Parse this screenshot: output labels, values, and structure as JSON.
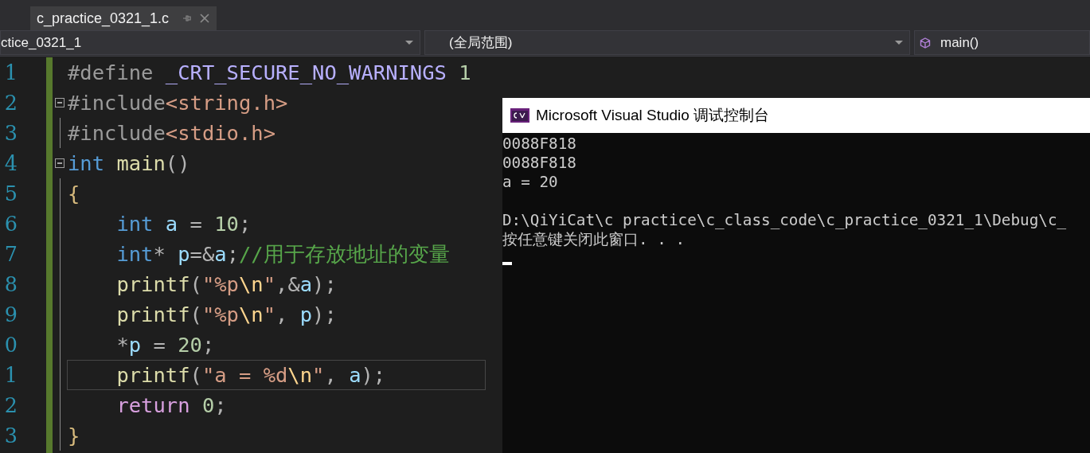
{
  "tab": {
    "label": "c_practice_0321_1.c",
    "selected": true
  },
  "nav_bar": [
    {
      "label": "ctice_0321_1",
      "kind": "dropdown"
    },
    {
      "label": "(全局范围)",
      "kind": "dropdown"
    },
    {
      "label": "main()",
      "kind": "member"
    }
  ],
  "editor": {
    "lines": [
      {
        "number": "1",
        "fold": false,
        "current": false,
        "tokens": [
          {
            "kind": "preproc",
            "text": "#define "
          },
          {
            "kind": "macro",
            "text": "_CRT_SECURE_NO_WARNINGS"
          },
          {
            "kind": "number",
            "text": " 1"
          }
        ]
      },
      {
        "number": "2",
        "fold": true,
        "current": false,
        "tokens": [
          {
            "kind": "preproc",
            "text": "#include"
          },
          {
            "kind": "string",
            "text": "<string.h>"
          }
        ]
      },
      {
        "number": "3",
        "fold": false,
        "current": false,
        "tokens": [
          {
            "kind": "preproc",
            "text": "#include"
          },
          {
            "kind": "string",
            "text": "<stdio.h>"
          }
        ]
      },
      {
        "number": "4",
        "fold": true,
        "current": false,
        "tokens": [
          {
            "kind": "keyword",
            "text": "int "
          },
          {
            "kind": "function",
            "text": "main"
          },
          {
            "kind": "punct",
            "text": "()"
          }
        ]
      },
      {
        "number": "5",
        "fold": false,
        "current": false,
        "tokens": [
          {
            "kind": "brace",
            "text": "{"
          }
        ]
      },
      {
        "number": "6",
        "fold": false,
        "current": false,
        "tokens": [
          {
            "kind": "keyword",
            "text": "    int "
          },
          {
            "kind": "variable",
            "text": "a"
          },
          {
            "kind": "punct",
            "text": " = "
          },
          {
            "kind": "number",
            "text": "10"
          },
          {
            "kind": "punct",
            "text": ";"
          }
        ]
      },
      {
        "number": "7",
        "fold": false,
        "current": false,
        "tokens": [
          {
            "kind": "keyword",
            "text": "    int"
          },
          {
            "kind": "punct",
            "text": "* "
          },
          {
            "kind": "variable",
            "text": "p"
          },
          {
            "kind": "punct",
            "text": "=&"
          },
          {
            "kind": "variable",
            "text": "a"
          },
          {
            "kind": "punct",
            "text": ";"
          },
          {
            "kind": "comment",
            "text": "//用于存放地址的变量"
          }
        ]
      },
      {
        "number": "8",
        "fold": false,
        "current": false,
        "tokens": [
          {
            "kind": "function",
            "text": "    printf"
          },
          {
            "kind": "punct",
            "text": "("
          },
          {
            "kind": "string",
            "text": "\"%p"
          },
          {
            "kind": "escape",
            "text": "\\n"
          },
          {
            "kind": "string",
            "text": "\""
          },
          {
            "kind": "punct",
            "text": ",&"
          },
          {
            "kind": "variable",
            "text": "a"
          },
          {
            "kind": "punct",
            "text": ");"
          }
        ]
      },
      {
        "number": "9",
        "fold": false,
        "current": false,
        "tokens": [
          {
            "kind": "function",
            "text": "    printf"
          },
          {
            "kind": "punct",
            "text": "("
          },
          {
            "kind": "string",
            "text": "\"%p"
          },
          {
            "kind": "escape",
            "text": "\\n"
          },
          {
            "kind": "string",
            "text": "\""
          },
          {
            "kind": "punct",
            "text": ", "
          },
          {
            "kind": "variable",
            "text": "p"
          },
          {
            "kind": "punct",
            "text": ");"
          }
        ]
      },
      {
        "number": "0",
        "fold": false,
        "current": false,
        "tokens": [
          {
            "kind": "punct",
            "text": "    *"
          },
          {
            "kind": "variable",
            "text": "p"
          },
          {
            "kind": "punct",
            "text": " = "
          },
          {
            "kind": "number",
            "text": "20"
          },
          {
            "kind": "punct",
            "text": ";"
          }
        ]
      },
      {
        "number": "1",
        "fold": false,
        "current": true,
        "tokens": [
          {
            "kind": "function",
            "text": "    printf"
          },
          {
            "kind": "punct",
            "text": "("
          },
          {
            "kind": "string",
            "text": "\"a = %d"
          },
          {
            "kind": "escape",
            "text": "\\n"
          },
          {
            "kind": "string",
            "text": "\""
          },
          {
            "kind": "punct",
            "text": ", "
          },
          {
            "kind": "variable",
            "text": "a"
          },
          {
            "kind": "punct",
            "text": ");"
          }
        ]
      },
      {
        "number": "2",
        "fold": false,
        "current": false,
        "tokens": [
          {
            "kind": "control",
            "text": "    return "
          },
          {
            "kind": "number",
            "text": "0"
          },
          {
            "kind": "punct",
            "text": ";"
          }
        ]
      },
      {
        "number": "3",
        "fold": false,
        "current": false,
        "tokens": [
          {
            "kind": "brace",
            "text": "}"
          }
        ]
      }
    ]
  },
  "console": {
    "title": "Microsoft Visual Studio 调试控制台",
    "output_lines": [
      "0088F818",
      "0088F818",
      "a = 20"
    ],
    "exit_lines": [
      "D:\\QiYiCat\\c practice\\c_class_code\\c_practice_0321_1\\Debug\\c_",
      "按任意键关闭此窗口. . ."
    ]
  }
}
